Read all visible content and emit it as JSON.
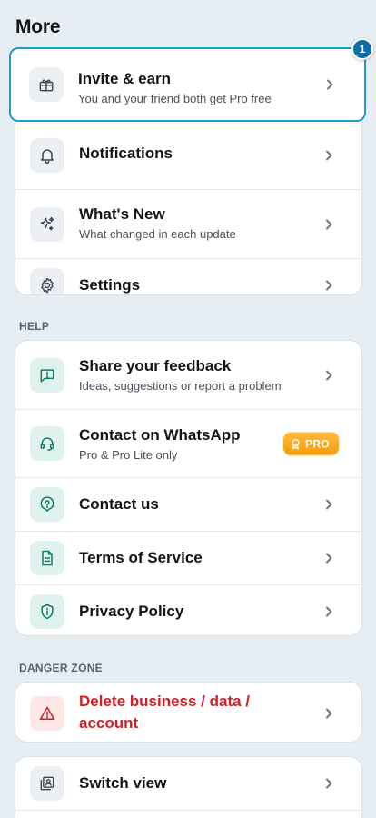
{
  "header": {
    "title": "More"
  },
  "tour": {
    "step": "1"
  },
  "top_items": [
    {
      "title": "Invite & earn",
      "subtitle": "You and your friend both get Pro free",
      "icon": "gift-icon"
    },
    {
      "title": "Notifications",
      "icon": "bell-icon"
    },
    {
      "title": "What's New",
      "subtitle": "What changed in each update",
      "icon": "sparkles-icon"
    },
    {
      "title": "Settings",
      "icon": "gear-icon"
    }
  ],
  "help": {
    "label": "HELP",
    "items": [
      {
        "title": "Share your feedback",
        "subtitle": "Ideas, suggestions or report a problem",
        "icon": "feedback-icon"
      },
      {
        "title": "Contact on WhatsApp",
        "subtitle": "Pro & Pro Lite only",
        "icon": "headset-icon",
        "badge": "PRO"
      },
      {
        "title": "Contact us",
        "icon": "help-circle-icon"
      },
      {
        "title": "Terms of Service",
        "icon": "document-icon"
      },
      {
        "title": "Privacy Policy",
        "icon": "shield-icon"
      }
    ]
  },
  "danger": {
    "label": "DANGER ZONE",
    "items": [
      {
        "title": "Delete business / data / account",
        "icon": "warning-icon"
      }
    ]
  },
  "bottom_items": [
    {
      "title": "Switch view",
      "icon": "switch-view-icon"
    }
  ],
  "colors": {
    "accent": "#1e9bd2",
    "teal": "#0e7b6c",
    "danger": "#d21f26",
    "pro": "#f5a623",
    "background": "#e6eef4"
  }
}
